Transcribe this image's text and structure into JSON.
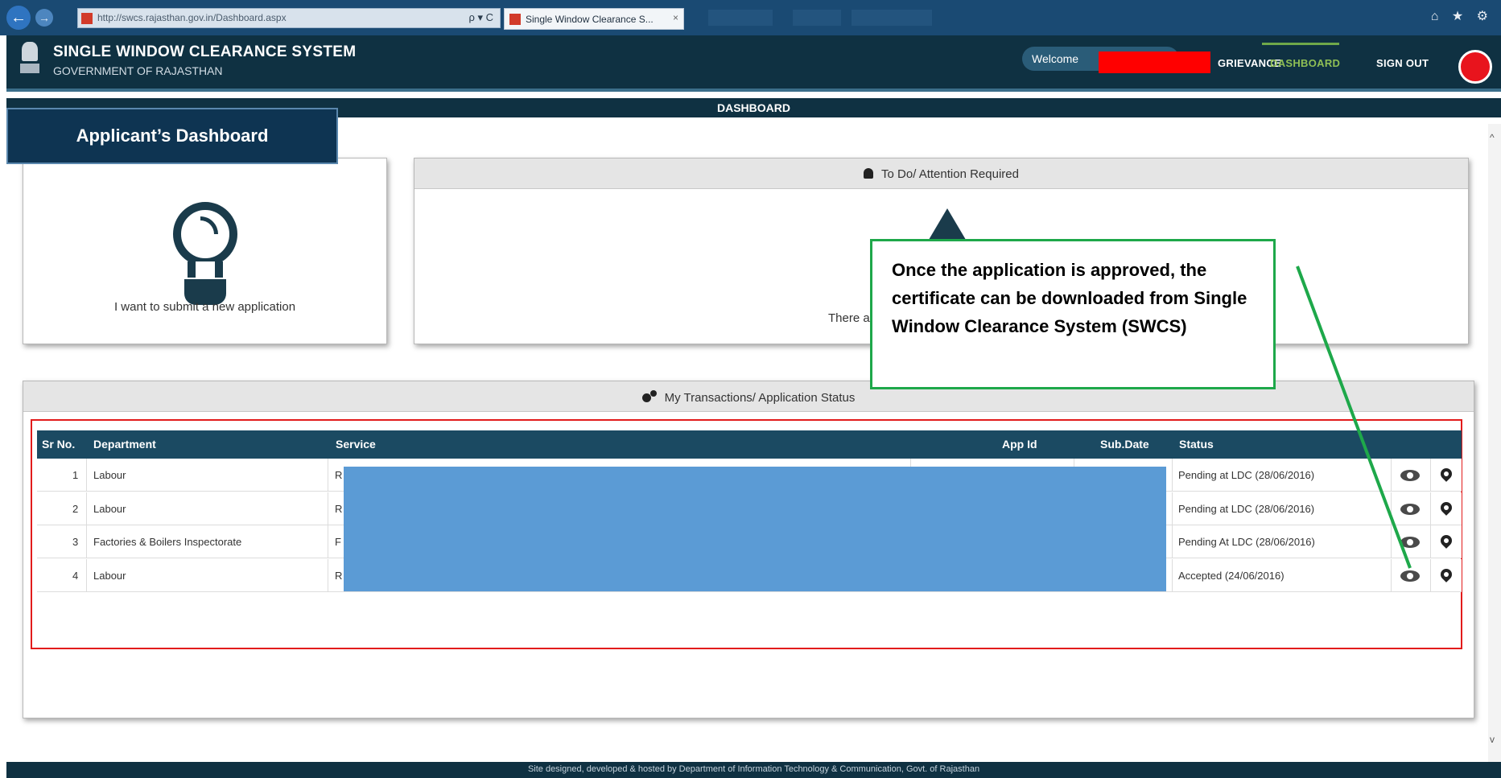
{
  "browser": {
    "url": "http://swcs.rajasthan.gov.in/Dashboard.aspx",
    "address_controls": "ρ ▾ C",
    "tab_title": "Single Window Clearance S...",
    "tab_close": "×",
    "back_icon": "back-arrow-icon",
    "forward_icon": "forward-arrow-icon",
    "right_icons": "⌂ ★ ⚙"
  },
  "header": {
    "title": "SINGLE WINDOW CLEARANCE SYSTEM",
    "subtitle": "GOVERNMENT OF RAJASTHAN",
    "welcome": "Welcome",
    "nav": [
      {
        "label": "GRIEVANCE"
      },
      {
        "label": "DASHBOARD",
        "active": true
      },
      {
        "label": "SIGN OUT"
      }
    ]
  },
  "dashboard_strip": "DASHBOARD",
  "applicant_title": "Applicant’s Dashboard",
  "new_application": {
    "caption": "I want to submit a new application",
    "icon": "lightbulb-icon"
  },
  "todo": {
    "title": "To Do/ Attention Required",
    "icon": "bell-icon",
    "message": "There a"
  },
  "transactions": {
    "title": "My Transactions/ Application Status",
    "icon": "gears-icon",
    "columns": [
      "Sr No.",
      "Department",
      "Service",
      "App Id",
      "Sub.Date",
      "Status"
    ],
    "rows": [
      {
        "sr": "1",
        "department": "Labour",
        "service": "R",
        "status": "Pending at LDC (28/06/2016)"
      },
      {
        "sr": "2",
        "department": "Labour",
        "service": "R",
        "status": "Pending at LDC (28/06/2016)"
      },
      {
        "sr": "3",
        "department": "Factories & Boilers Inspectorate",
        "service": "F",
        "status": "Pending At LDC (28/06/2016)"
      },
      {
        "sr": "4",
        "department": "Labour",
        "service": "R",
        "status": "Accepted (24/06/2016)"
      }
    ],
    "row_icons": [
      "eye-icon",
      "map-pin-icon"
    ]
  },
  "callout": {
    "text": "Once the application is approved, the certificate can be downloaded from Single Window Clearance System (SWCS)"
  },
  "footer": "Site designed, developed & hosted by Department of Information Technology & Communication, Govt. of Rajasthan",
  "colors": {
    "header_bg": "#0f3142",
    "active_nav": "#8fbf55",
    "callout_border": "#1ea84a",
    "highlight_frame": "#e21b1b",
    "redaction_blue": "#5b9bd5",
    "redaction_red": "#ff0000",
    "table_header": "#1b4a62"
  }
}
